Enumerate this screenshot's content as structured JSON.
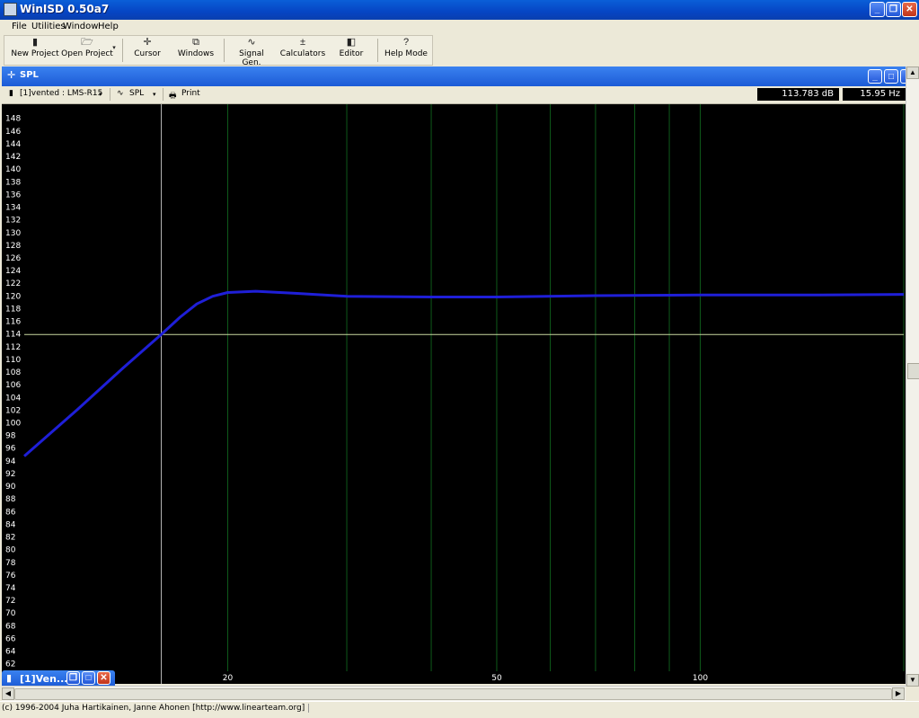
{
  "app": {
    "title": "WinISD 0.50a7"
  },
  "menu": [
    "File",
    "Utilities",
    "Window",
    "Help"
  ],
  "toolbar": {
    "new_project": "New Project",
    "open_project": "Open Project",
    "cursor": "Cursor",
    "windows": "Windows",
    "signal_gen": "Signal Gen.",
    "calculators": "Calculators",
    "editor": "Editor",
    "help_mode": "Help Mode"
  },
  "child": {
    "title": "SPL",
    "project_select": "[1]vented : LMS-R15",
    "graph_select": "SPL",
    "print": "Print",
    "readout_db": "113.783 dB",
    "readout_hz": "15.95 Hz",
    "minimized_title": "[1]Ven..."
  },
  "status": {
    "text": "(c) 1996-2004 Juha Hartikainen, Janne Ahonen [http://www.linearteam.org]"
  },
  "colors": {
    "plot_bg": "#000000",
    "grid": "#0e5a1a",
    "curve": "#1f1fd8",
    "cursor": "#c8d8a0",
    "title": "#0a5fd8"
  },
  "chart_data": {
    "type": "line",
    "y_tick_labels": [
      "148",
      "146",
      "144",
      "142",
      "140",
      "138",
      "136",
      "134",
      "132",
      "130",
      "128",
      "126",
      "124",
      "122",
      "120",
      "118",
      "116",
      "114",
      "112",
      "110",
      "108",
      "106",
      "104",
      "102",
      "100",
      "98",
      "96",
      "94",
      "92",
      "90",
      "88",
      "86",
      "84",
      "82",
      "80",
      "78",
      "76",
      "74",
      "72",
      "70",
      "68",
      "66",
      "64",
      "62"
    ],
    "x_tick_labels": [
      "20",
      "50",
      "100"
    ],
    "ylim": [
      60,
      150
    ],
    "xlim": [
      10,
      200
    ],
    "x_scale": "log",
    "cursor": {
      "x": 15.95,
      "y": 113.783
    },
    "series": [
      {
        "x": [
          10,
          12,
          14,
          15.95,
          17,
          18,
          19,
          20,
          22,
          25,
          30,
          40,
          50,
          70,
          100,
          150,
          200
        ],
        "y": [
          94.6,
          102,
          108.5,
          113.8,
          116.5,
          118.6,
          119.8,
          120.4,
          120.6,
          120.3,
          119.8,
          119.7,
          119.7,
          119.9,
          120.0,
          120.0,
          120.1
        ]
      }
    ]
  }
}
